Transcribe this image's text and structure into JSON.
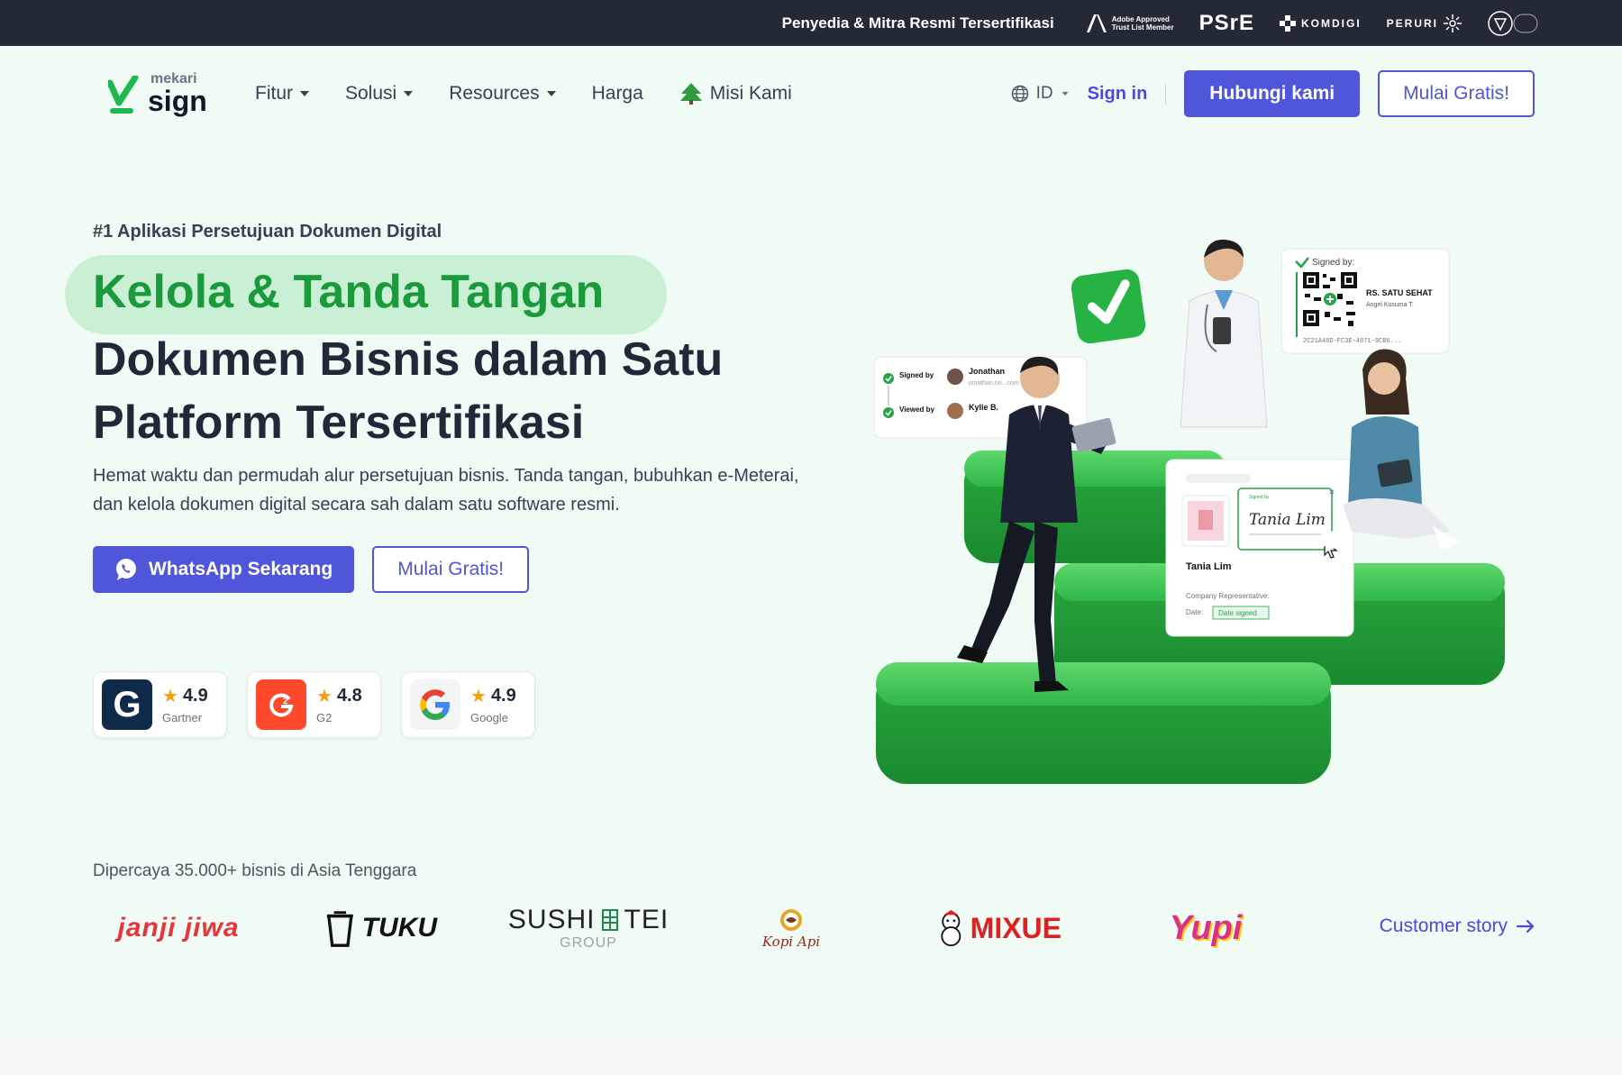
{
  "topbar": {
    "text": "Penyedia & Mitra Resmi Tersertifikasi",
    "partners": {
      "adobe_line1": "Adobe Approved",
      "adobe_line2": "Trust List Member",
      "psre": "PSrE",
      "komdigi": "KOMDIGI",
      "peruri": "PERURI"
    }
  },
  "logo": {
    "sub": "mekari",
    "main": "sign"
  },
  "nav": {
    "links": [
      "Fitur",
      "Solusi",
      "Resources",
      "Harga",
      "Misi Kami"
    ],
    "lang": "ID",
    "signin": "Sign in",
    "contact": "Hubungi kami",
    "start": "Mulai Gratis!"
  },
  "hero": {
    "eyebrow": "#1 Aplikasi Persetujuan Dokumen Digital",
    "title_highlight": "Kelola & Tanda Tangan",
    "title_line2": "Dokumen Bisnis dalam Satu",
    "title_line3": "Platform Tersertifikasi",
    "description": "Hemat waktu dan permudah alur persetujuan bisnis. Tanda tangan, bubuhkan e-Meterai, dan kelola dokumen digital secara sah dalam satu software resmi.",
    "cta_whatsapp": "WhatsApp Sekarang",
    "cta_start": "Mulai Gratis!"
  },
  "ratings": [
    {
      "score": "4.9",
      "source": "Gartner",
      "letter": "G",
      "color": "#0f2a4a"
    },
    {
      "score": "4.8",
      "source": "G2",
      "letter": "G",
      "color": "#ff492c"
    },
    {
      "score": "4.9",
      "source": "Google",
      "letter": "G",
      "color": "#ffffff"
    }
  ],
  "illustration": {
    "signed_by": "Signed by:",
    "hospital": "RS. SATU SEHAT",
    "hospital_signer": "Angel Kusuma T.",
    "doc_id": "2C21A46D-FC3E-4071-9CB6...",
    "signed_label": "Signed by",
    "viewed_label": "Viewed by",
    "signer1": "Jonathan",
    "signer1_email": "jonathan.no...com",
    "signer2": "Kylie B.",
    "signer_card_name": "Tania Lim",
    "signature_text": "Tania Lim",
    "company_rep": "Company Representative:",
    "date_label": "Date:",
    "date_value": "Date signed"
  },
  "trusted": {
    "label": "Dipercaya 35.000+ bisnis di Asia Tenggara",
    "brands": [
      "janji jiwa",
      "TUKU",
      "SUSHI",
      "TEI",
      "GROUP",
      "Kopi Api",
      "MIXUE",
      "Yupi"
    ],
    "customer_story": "Customer story"
  },
  "colors": {
    "primary": "#4f56d9",
    "green": "#1b9a3c",
    "highlight": "#c9f0d5",
    "topbar": "#232a36"
  }
}
